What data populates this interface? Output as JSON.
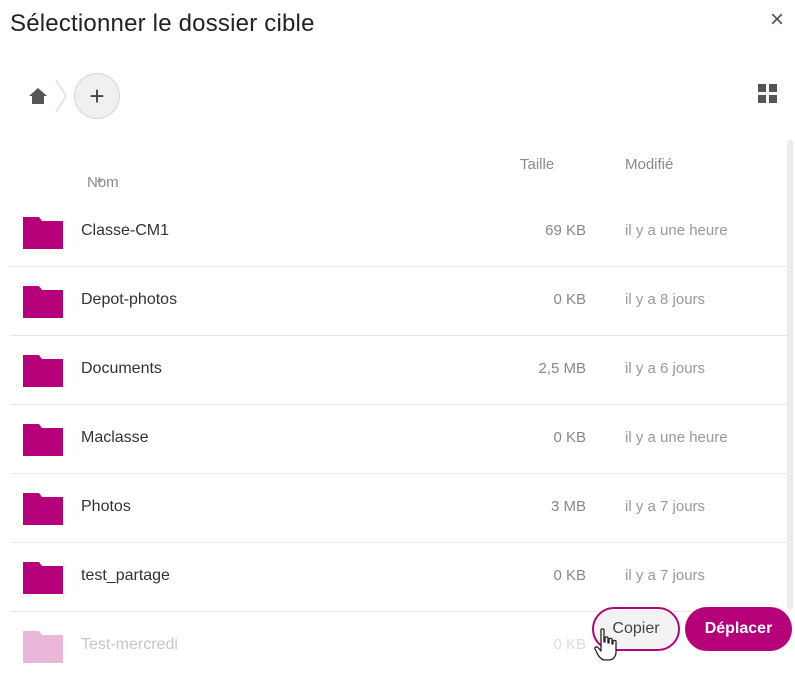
{
  "dialog": {
    "title": "Sélectionner le dossier cible",
    "close_label": "×"
  },
  "toolbar": {
    "add_label": "+",
    "home_icon": "home-icon",
    "grid_icon": "grid-view-icon"
  },
  "table": {
    "columns": {
      "name": "Nom",
      "size": "Taille",
      "modified": "Modifié"
    },
    "sort_indicator": "▲",
    "rows": [
      {
        "name": "Classe-CM1",
        "size": "69 KB",
        "modified": "il y a une heure"
      },
      {
        "name": "Depot-photos",
        "size": "0 KB",
        "modified": "il y a 8 jours"
      },
      {
        "name": "Documents",
        "size": "2,5 MB",
        "modified": "il y a 6 jours"
      },
      {
        "name": "Maclasse",
        "size": "0 KB",
        "modified": "il y a une heure"
      },
      {
        "name": "Photos",
        "size": "3 MB",
        "modified": "il y a 7 jours"
      },
      {
        "name": "test_partage",
        "size": "0 KB",
        "modified": "il y a 7 jours"
      },
      {
        "name": "Test-mercredi",
        "size": "0 KB",
        "modified": ""
      }
    ]
  },
  "actions": {
    "copy_label": "Copier",
    "move_label": "Déplacer"
  },
  "colors": {
    "accent": "#b5007a",
    "folder": "#b5007a"
  }
}
